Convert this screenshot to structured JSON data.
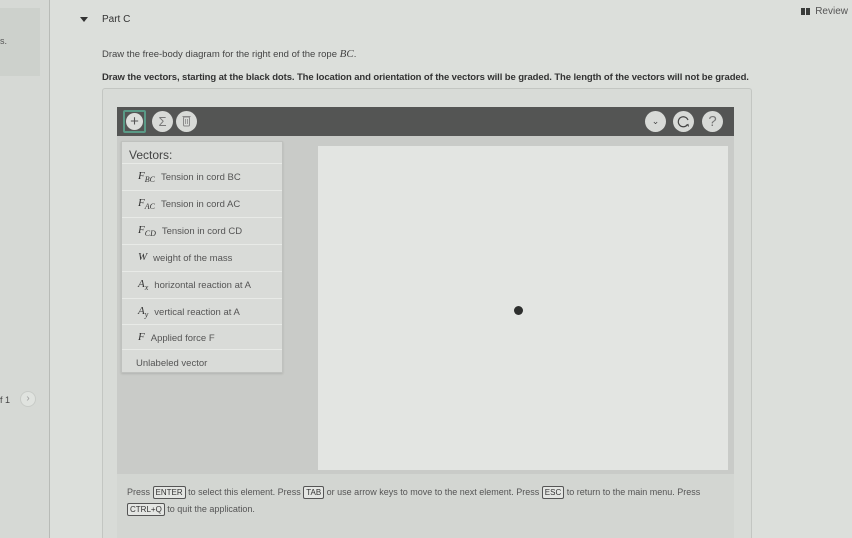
{
  "sidebar": {
    "text_fragment": "s.",
    "page_fragment": "f 1",
    "next_icon": "chevron-right-icon"
  },
  "header": {
    "review_label": "Review",
    "review_icon": "book-icon",
    "part_label": "Part C",
    "collapse_icon": "caret-down-icon"
  },
  "instructions": {
    "line1_prefix": "Draw the free-body diagram for the right end of the rope ",
    "line1_math": "BC",
    "line1_suffix": ".",
    "line2": "Draw the vectors, starting at the black dots. The location and orientation of the vectors will be graded. The length of the vectors will not be graded."
  },
  "toolbar": {
    "add_icon": "+",
    "sum_icon": "Σ",
    "delete_icon": "🗑",
    "chevron_icon": "⌄",
    "reset_icon": "↻",
    "help_icon": "?"
  },
  "vectors_panel": {
    "title": "Vectors:",
    "items": [
      {
        "symbol": "F",
        "sub": "BC",
        "label": "Tension in cord BC"
      },
      {
        "symbol": "F",
        "sub": "AC",
        "label": "Tension in cord AC"
      },
      {
        "symbol": "F",
        "sub": "CD",
        "label": "Tension in cord CD"
      },
      {
        "symbol": "W",
        "sub": "",
        "label": "weight of the mass"
      },
      {
        "symbol": "A",
        "sub": "x",
        "label": "horizontal reaction at A"
      },
      {
        "symbol": "A",
        "sub": "y",
        "label": "vertical reaction at A"
      },
      {
        "symbol": "F",
        "sub": "",
        "label": "Applied force F"
      }
    ],
    "unlabeled": "Unlabeled vector"
  },
  "footer": {
    "t1": "Press ",
    "k1": "ENTER",
    "t2": " to select this element. Press ",
    "k2": "TAB",
    "t3": " or use arrow keys to move to the next element. Press ",
    "k3": "ESC",
    "t4": " to return to the main menu. Press ",
    "k4": "CTRL+Q",
    "t5": " to quit the application."
  }
}
